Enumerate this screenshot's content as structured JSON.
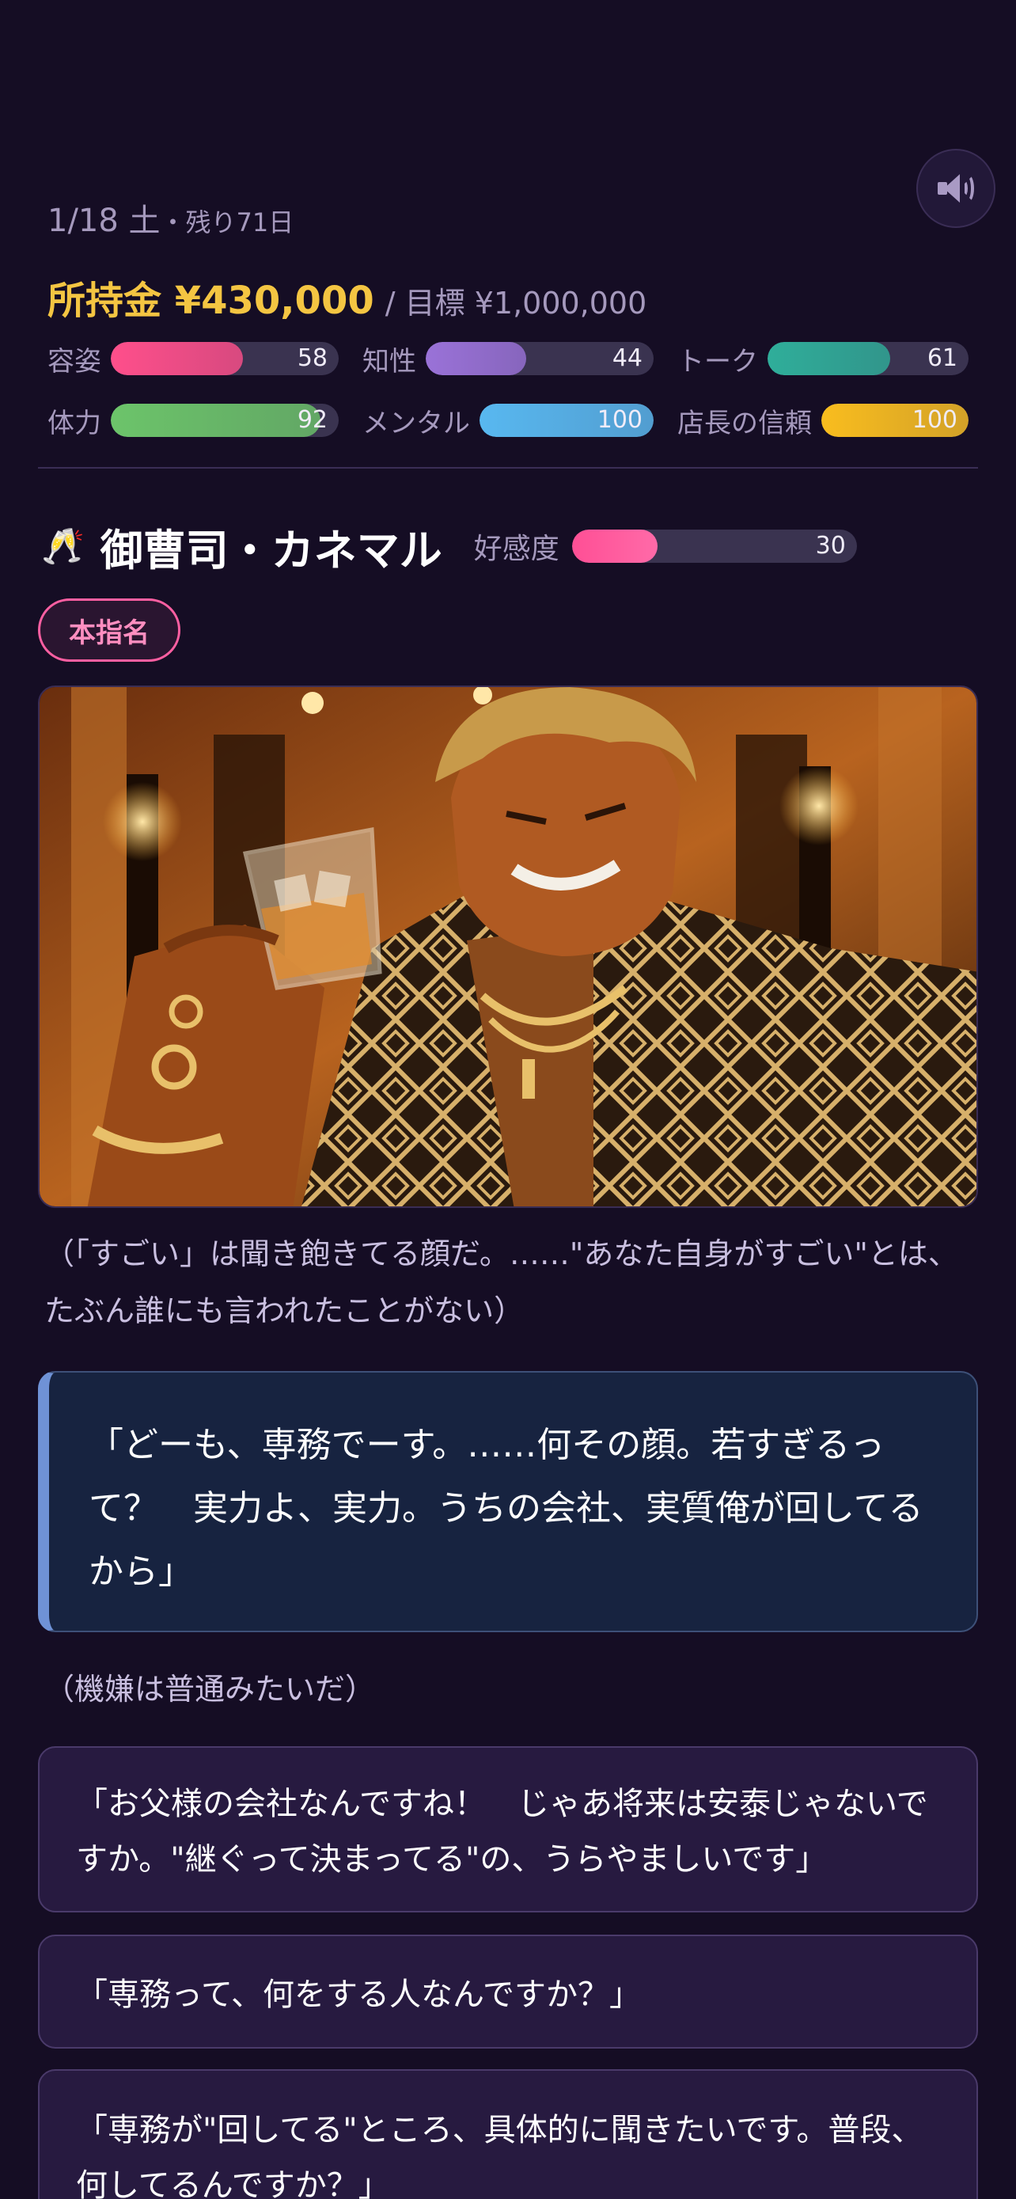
{
  "status": {
    "date": "1/18 土",
    "remaining": "・残り71日",
    "money": "所持金 ¥430,000",
    "goal": "/ 目標 ¥1,000,000"
  },
  "stats": [
    {
      "label": "容姿",
      "value": "58",
      "percent": 58,
      "color": "#ff4f8b"
    },
    {
      "label": "知性",
      "value": "44",
      "percent": 44,
      "color": "#9a72d8"
    },
    {
      "label": "トーク",
      "value": "61",
      "percent": 61,
      "color": "#2fae9a"
    },
    {
      "label": "体力",
      "value": "92",
      "percent": 92,
      "color": "#6cc46a"
    },
    {
      "label": "メンタル",
      "value": "100",
      "percent": 100,
      "color": "#58b8f0"
    },
    {
      "label": "店長の信頼",
      "value": "100",
      "percent": 100,
      "color": "#f9bd1e"
    }
  ],
  "character": {
    "icon": "champagne-glass-icon",
    "name": "御曹司・カネマル",
    "affection_label": "好感度",
    "affection_value": "30",
    "affection_percent": 30,
    "badge": "本指名"
  },
  "narration_1": "（「すごい」は聞き飽きてる顔だ。……\"あなた自身がすごい\"とは、たぶん誰にも言われたことがない）",
  "speech": "「どーも、専務でーす。……何その顔。若すぎるって？　実力よ、実力。うちの会社、実質俺が回してるから」",
  "narration_2": "（機嫌は普通みたいだ）",
  "choices": [
    "「お父様の会社なんですね！　じゃあ将来は安泰じゃないですか。\"継ぐって決まってる\"の、うらやましいです」",
    "「専務って、何をする人なんですか？」",
    "「専務が\"回してる\"ところ、具体的に聞きたいです。普段、何してるんですか？」"
  ]
}
